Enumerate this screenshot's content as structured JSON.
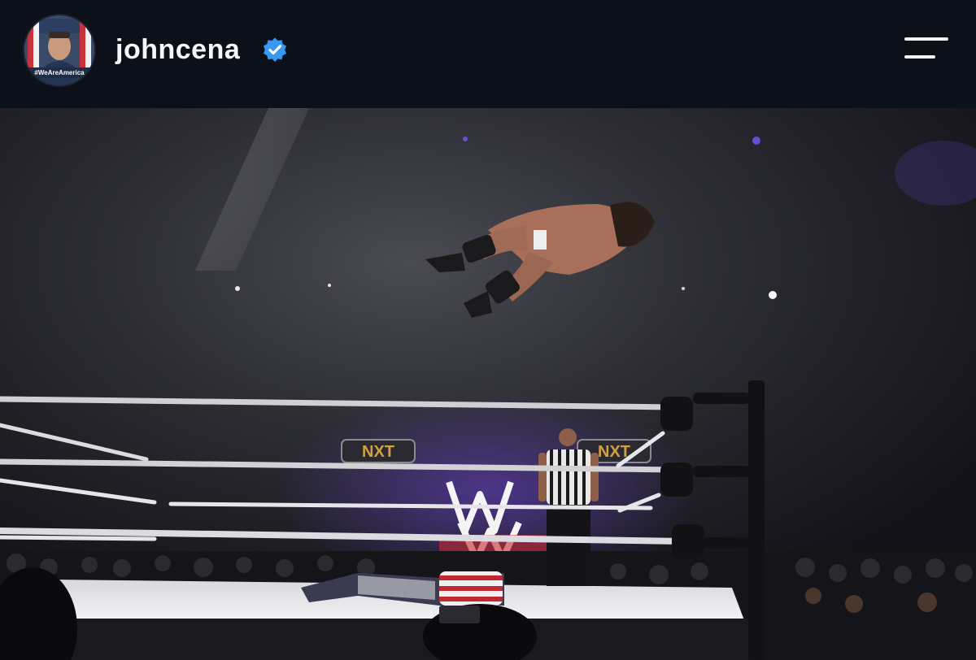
{
  "profile": {
    "username": "johncena",
    "verified": true,
    "avatar_caption": "#WeAreAmerica",
    "avatar_icon": "profile-avatar"
  },
  "header": {
    "menu_icon": "hamburger-menu-icon"
  },
  "photo": {
    "description_icon": "post-photo",
    "logo_text": "NXT"
  },
  "colors": {
    "header_bg": "#0c1019",
    "verified_blue": "#3897f0",
    "text": "#f4f6fa"
  }
}
